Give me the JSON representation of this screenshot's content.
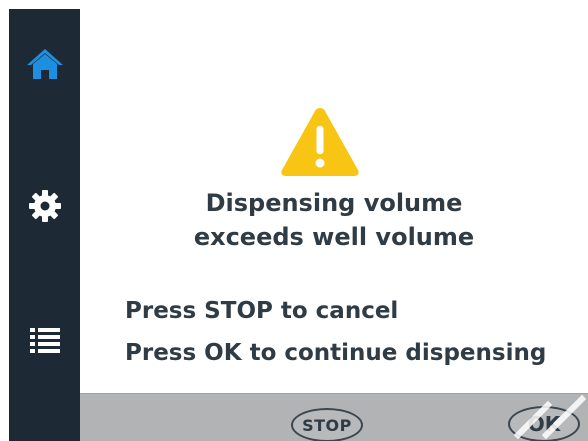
{
  "sidebar": {
    "items": [
      {
        "id": "home",
        "icon": "home-icon",
        "active": true
      },
      {
        "id": "settings",
        "icon": "gear-icon",
        "active": false
      },
      {
        "id": "list",
        "icon": "list-icon",
        "active": false
      }
    ]
  },
  "alert": {
    "icon": "warning-icon",
    "title_line1": "Dispensing volume",
    "title_line2": "exceeds well volume",
    "instruction_stop": "Press STOP to cancel",
    "instruction_ok": "Press OK to continue dispensing"
  },
  "footer": {
    "stop_label": "STOP",
    "ok_label": "OK"
  },
  "colors": {
    "sidebar_bg": "#1d2a35",
    "accent_blue": "#1e8fe0",
    "warning_yellow": "#f9c514",
    "text_dark": "#2f3b45",
    "footer_bg": "#b1b3b5"
  }
}
